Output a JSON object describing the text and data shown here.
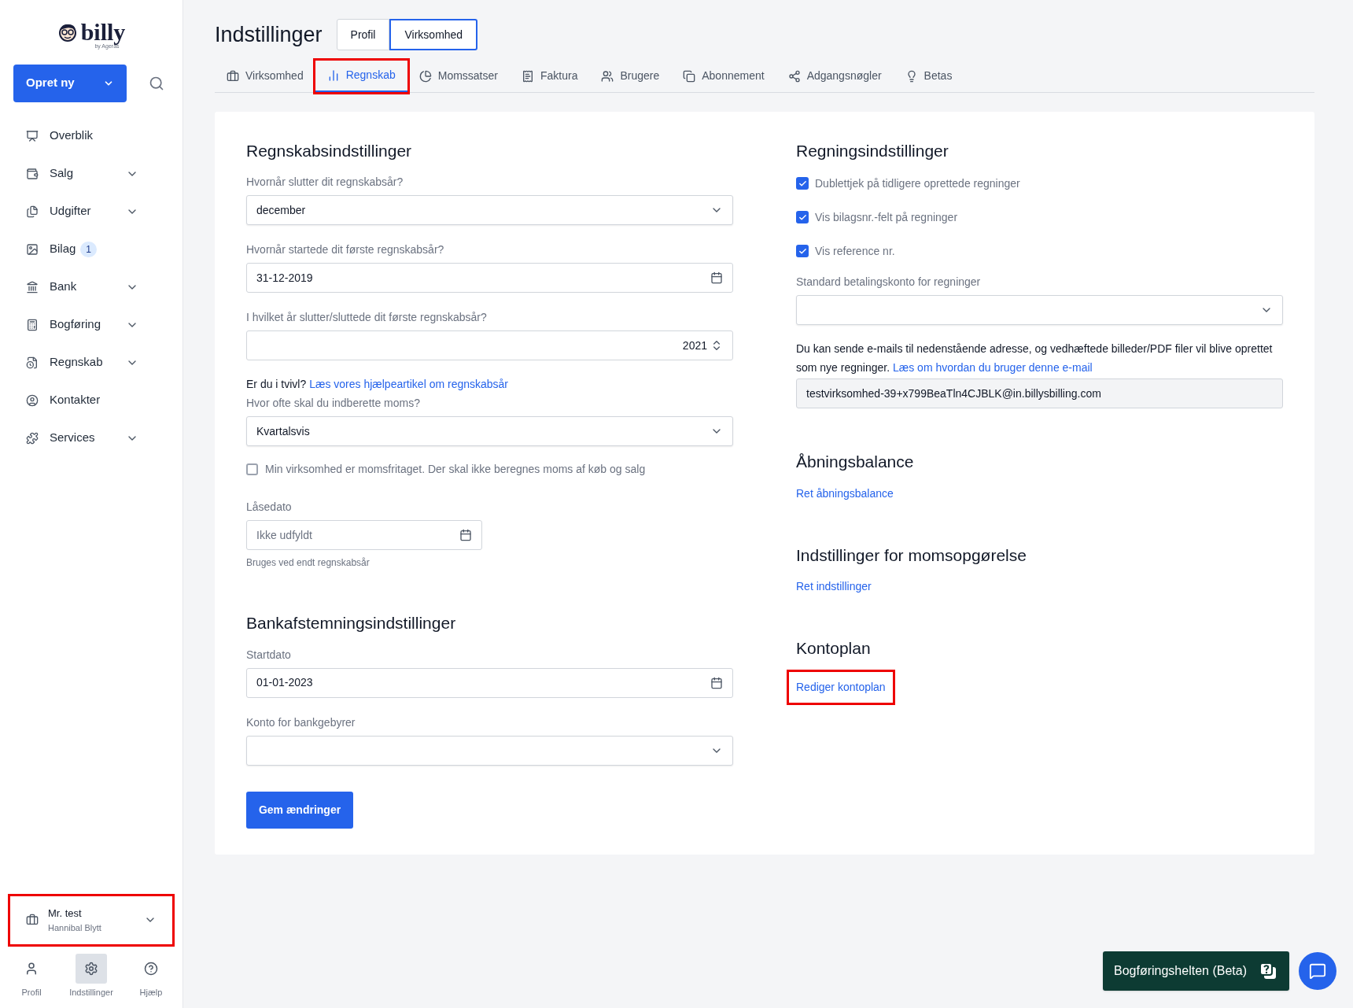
{
  "sidebar": {
    "logo": "billy",
    "logo_sub": "by Ageras",
    "create_button": "Opret ny",
    "items": [
      {
        "label": "Overblik",
        "expandable": false
      },
      {
        "label": "Salg",
        "expandable": true
      },
      {
        "label": "Udgifter",
        "expandable": true
      },
      {
        "label": "Bilag",
        "badge": "1",
        "expandable": false
      },
      {
        "label": "Bank",
        "expandable": true
      },
      {
        "label": "Bogføring",
        "expandable": true
      },
      {
        "label": "Regnskab",
        "expandable": true
      },
      {
        "label": "Kontakter",
        "expandable": false
      },
      {
        "label": "Services",
        "expandable": true
      }
    ],
    "account": {
      "name": "Mr. test",
      "subtitle": "Hannibal Blytt",
      "highlighted": true
    },
    "bottom_nav": [
      {
        "label": "Profil",
        "selected": false
      },
      {
        "label": "Indstillinger",
        "selected": true
      },
      {
        "label": "Hjælp",
        "selected": false
      }
    ]
  },
  "header": {
    "title": "Indstillinger",
    "segments": [
      {
        "label": "Profil",
        "selected": false
      },
      {
        "label": "Virksomhed",
        "selected": true
      }
    ]
  },
  "tabs": [
    {
      "label": "Virksomhed",
      "selected": false,
      "highlighted": false
    },
    {
      "label": "Regnskab",
      "selected": true,
      "highlighted": true
    },
    {
      "label": "Momssatser",
      "selected": false,
      "highlighted": false
    },
    {
      "label": "Faktura",
      "selected": false,
      "highlighted": false
    },
    {
      "label": "Brugere",
      "selected": false,
      "highlighted": false
    },
    {
      "label": "Abonnement",
      "selected": false,
      "highlighted": false
    },
    {
      "label": "Adgangsnøgler",
      "selected": false,
      "highlighted": false
    },
    {
      "label": "Betas",
      "selected": false,
      "highlighted": false
    }
  ],
  "accounting": {
    "title": "Regnskabsindstillinger",
    "fiscal_end": {
      "label": "Hvornår slutter dit regnskabsår?",
      "value": "december"
    },
    "first_start": {
      "label": "Hvornår startede dit første regnskabsår?",
      "value": "31-12-2019"
    },
    "first_end_year": {
      "label": "I hvilket år slutter/sluttede dit første regnskabsår?",
      "value": "2021"
    },
    "help": {
      "text": "Er du i tvivl?",
      "link": "Læs vores hjælpeartikel om regnskabsår"
    },
    "vat_frequency": {
      "label": "Hvor ofte skal du indberette moms?",
      "value": "Kvartalsvis"
    },
    "vat_exempt": {
      "label": "Min virksomhed er momsfritaget. Der skal ikke beregnes moms af køb og salg",
      "checked": false
    },
    "lock_date": {
      "label": "Låsedato",
      "placeholder": "Ikke udfyldt",
      "hint": "Bruges ved endt regnskabsår"
    }
  },
  "bank": {
    "title": "Bankafstemningsindstillinger",
    "start_date": {
      "label": "Startdato",
      "value": "01-01-2023"
    },
    "fee_account": {
      "label": "Konto for bankgebyrer"
    }
  },
  "save_button": "Gem ændringer",
  "bills": {
    "title": "Regningsindstillinger",
    "checkboxes": [
      {
        "label": "Dublettjek på tidligere oprettede regninger",
        "checked": true
      },
      {
        "label": "Vis bilagsnr.-felt på regninger",
        "checked": true
      },
      {
        "label": "Vis reference nr.",
        "checked": true
      }
    ],
    "default_account": {
      "label": "Standard betalingskonto for regninger"
    },
    "email_info": {
      "text": "Du kan sende e-mails til nedenstående adresse, og vedhæftede billeder/PDF filer vil blive oprettet som nye regninger.",
      "link": "Læs om hvordan du bruger denne e-mail"
    },
    "email": {
      "value": "testvirksomhed-39+x799BeaTln4CJBLK@in.billysbilling.com"
    }
  },
  "links_sections": [
    {
      "title": "Åbningsbalance",
      "link": "Ret åbningsbalance",
      "highlighted": false
    },
    {
      "title": "Indstillinger for momsopgørelse",
      "link": "Ret indstillinger",
      "highlighted": false
    },
    {
      "title": "Kontoplan",
      "link": "Rediger kontoplan",
      "highlighted": true
    }
  ],
  "assistant_button": "Bogføringshelten (Beta)"
}
